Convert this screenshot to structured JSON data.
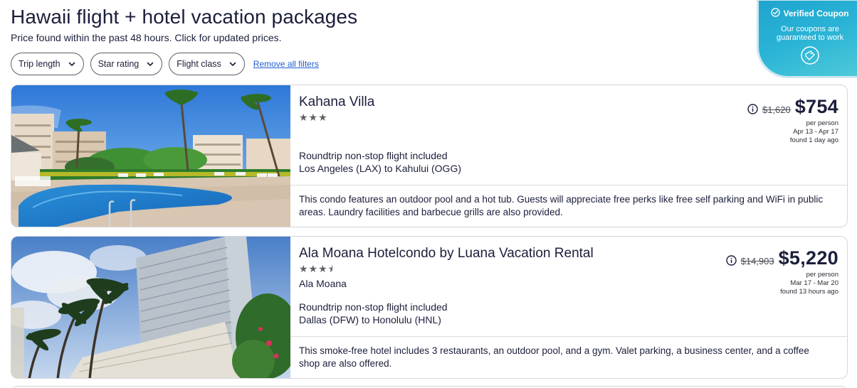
{
  "header": {
    "title": "Hawaii flight + hotel vacation packages",
    "subtitle": "Price found within the past 48 hours. Click for updated prices."
  },
  "filters": {
    "trip_length": "Trip length",
    "star_rating": "Star rating",
    "flight_class": "Flight class",
    "remove_all": "Remove all filters"
  },
  "coupon": {
    "title": "Verified Coupon",
    "line1": "Our coupons are",
    "line2": "guaranteed to work"
  },
  "listings": [
    {
      "name": "Kahana Villa",
      "stars": "★★★",
      "rating": 3,
      "location": "",
      "flight_note": "Roundtrip non-stop flight included",
      "route": "Los Angeles (LAX) to Kahului (OGG)",
      "description": "This condo features an outdoor pool and a hot tub. Guests will appreciate free perks like free self parking and WiFi in public areas. Laundry facilities and barbecue grills are also provided.",
      "old_price": "$1,620",
      "price": "$754",
      "per_person": "per person",
      "dates": "Apr 13 - Apr 17",
      "found": "found 1 day ago"
    },
    {
      "name": "Ala Moana Hotelcondo by Luana Vacation Rental",
      "stars": "★★★",
      "rating": 3.5,
      "location": "Ala Moana",
      "flight_note": "Roundtrip non-stop flight included",
      "route": "Dallas (DFW) to Honolulu (HNL)",
      "description": "This smoke-free hotel includes 3 restaurants, an outdoor pool, and a gym. Valet parking, a business center, and a coffee shop are also offered.",
      "old_price": "$14,903",
      "price": "$5,220",
      "per_person": "per person",
      "dates": "Mar 17 - Mar 20",
      "found": "found 13 hours ago"
    }
  ],
  "colors": {
    "link": "#1f5bd1",
    "coupon": "#2ab4d6",
    "text": "#1b1f3b"
  }
}
